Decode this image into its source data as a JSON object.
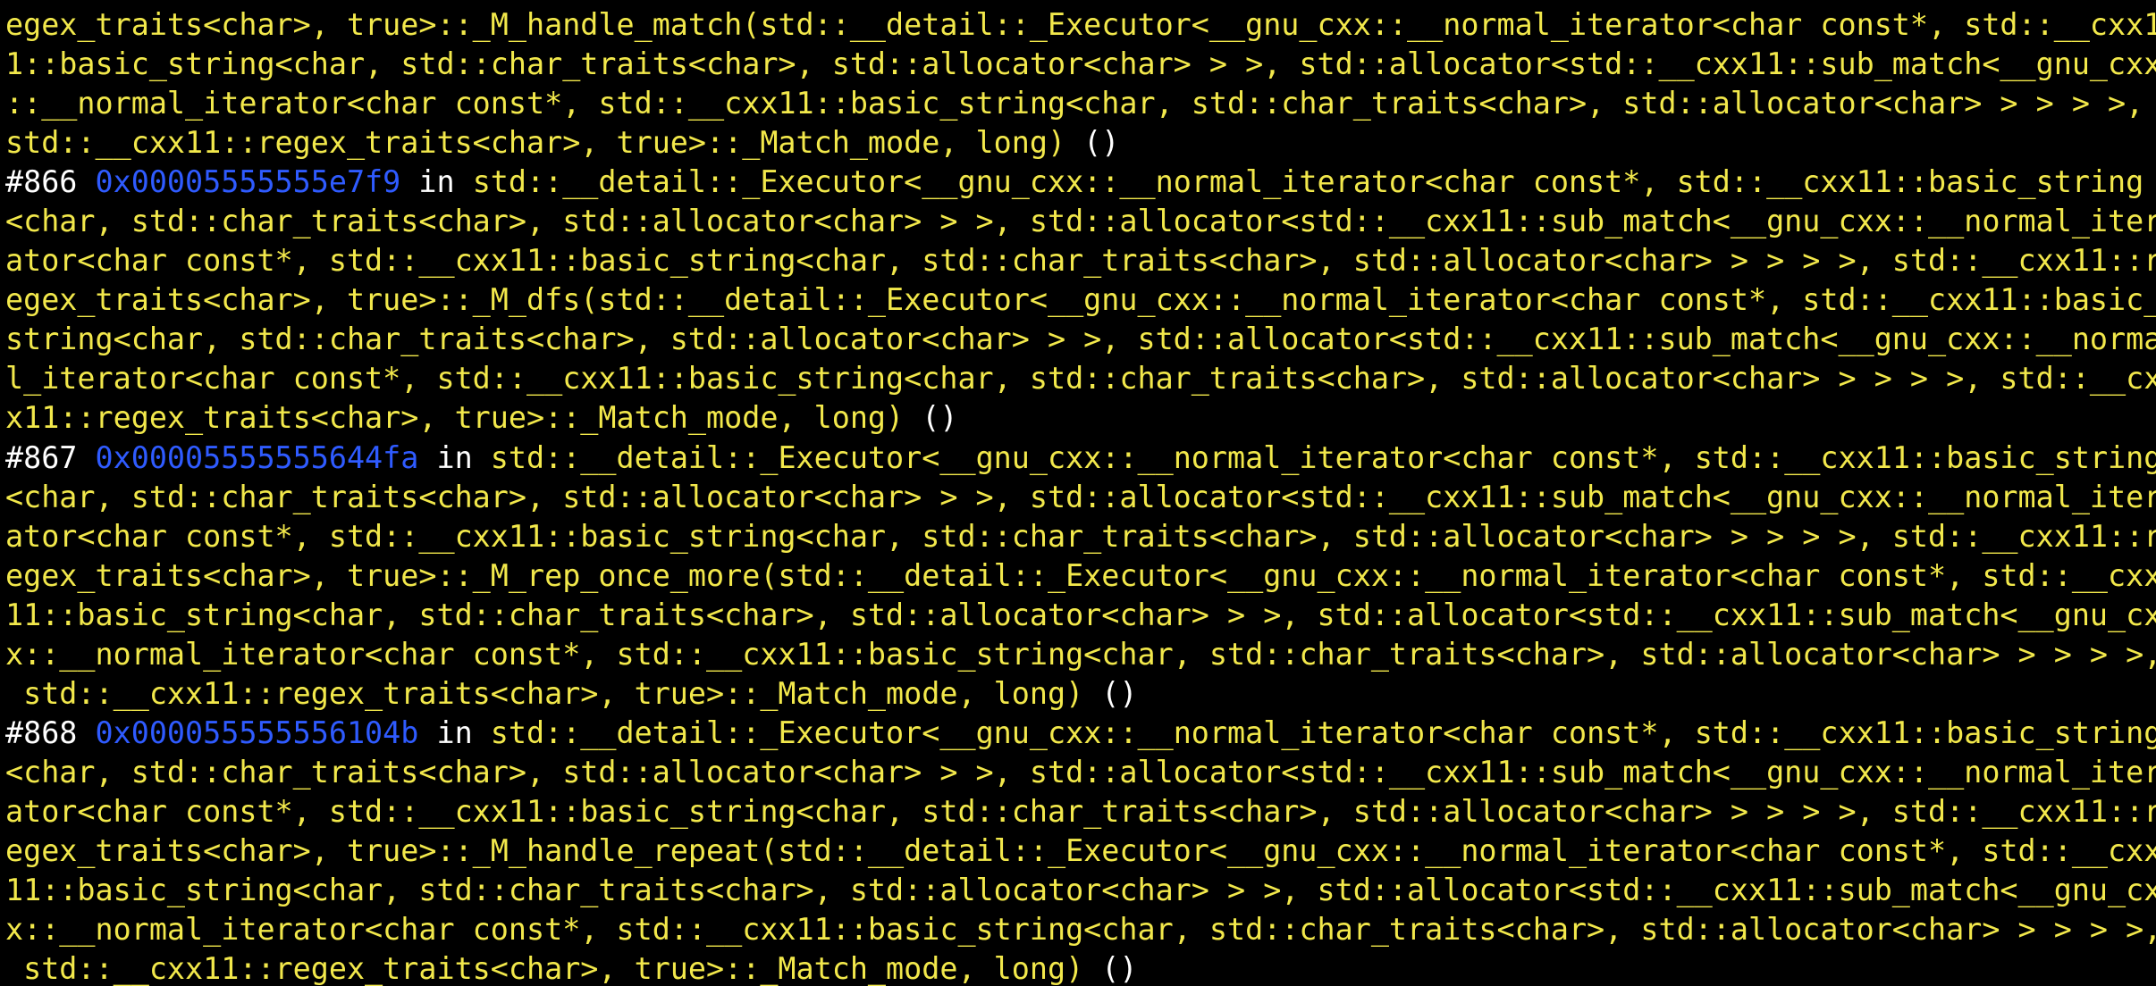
{
  "colors": {
    "background": "#000000",
    "text": "#ffffff",
    "function_text": "#f2e84b",
    "address_text": "#2f5bff"
  },
  "terminal": {
    "lines": [
      {
        "parts": [
          {
            "style": "fn",
            "text": "egex_traits<char>, true>::_M_handle_match(std::__detail::_Executor<__gnu_cxx::__normal_iterator<char const*, std::__cxx1"
          }
        ]
      },
      {
        "parts": [
          {
            "style": "fn",
            "text": "1::basic_string<char, std::char_traits<char>, std::allocator<char> > >, std::allocator<std::__cxx11::sub_match<__gnu_cxx"
          }
        ]
      },
      {
        "parts": [
          {
            "style": "fn",
            "text": "::__normal_iterator<char const*, std::__cxx11::basic_string<char, std::char_traits<char>, std::allocator<char> > > > >,"
          }
        ]
      },
      {
        "parts": [
          {
            "style": "fn",
            "text": "std::__cxx11::regex_traits<char>, true>::_Match_mode, long) "
          },
          {
            "style": "args",
            "text": "()"
          }
        ]
      },
      {
        "parts": [
          {
            "style": "num",
            "text": "#866 "
          },
          {
            "style": "addr",
            "text": "0x00005555555e7f9"
          },
          {
            "style": "kw",
            "text": " in "
          },
          {
            "style": "fn",
            "text": "std::__detail::_Executor<__gnu_cxx::__normal_iterator<char const*, std::__cxx11::basic_string"
          }
        ]
      },
      {
        "parts": [
          {
            "style": "fn",
            "text": "<char, std::char_traits<char>, std::allocator<char> > >, std::allocator<std::__cxx11::sub_match<__gnu_cxx::__normal_iter"
          }
        ]
      },
      {
        "parts": [
          {
            "style": "fn",
            "text": "ator<char const*, std::__cxx11::basic_string<char, std::char_traits<char>, std::allocator<char> > > > >, std::__cxx11::r"
          }
        ]
      },
      {
        "parts": [
          {
            "style": "fn",
            "text": "egex_traits<char>, true>::_M_dfs(std::__detail::_Executor<__gnu_cxx::__normal_iterator<char const*, std::__cxx11::basic_"
          }
        ]
      },
      {
        "parts": [
          {
            "style": "fn",
            "text": "string<char, std::char_traits<char>, std::allocator<char> > >, std::allocator<std::__cxx11::sub_match<__gnu_cxx::__norma"
          }
        ]
      },
      {
        "parts": [
          {
            "style": "fn",
            "text": "l_iterator<char const*, std::__cxx11::basic_string<char, std::char_traits<char>, std::allocator<char> > > > >, std::__cx"
          }
        ]
      },
      {
        "parts": [
          {
            "style": "fn",
            "text": "x11::regex_traits<char>, true>::_Match_mode, long) "
          },
          {
            "style": "args",
            "text": "()"
          }
        ]
      },
      {
        "parts": [
          {
            "style": "num",
            "text": "#867 "
          },
          {
            "style": "addr",
            "text": "0x00005555555644fa"
          },
          {
            "style": "kw",
            "text": " in "
          },
          {
            "style": "fn",
            "text": "std::__detail::_Executor<__gnu_cxx::__normal_iterator<char const*, std::__cxx11::basic_string"
          }
        ]
      },
      {
        "parts": [
          {
            "style": "fn",
            "text": "<char, std::char_traits<char>, std::allocator<char> > >, std::allocator<std::__cxx11::sub_match<__gnu_cxx::__normal_iter"
          }
        ]
      },
      {
        "parts": [
          {
            "style": "fn",
            "text": "ator<char const*, std::__cxx11::basic_string<char, std::char_traits<char>, std::allocator<char> > > > >, std::__cxx11::r"
          }
        ]
      },
      {
        "parts": [
          {
            "style": "fn",
            "text": "egex_traits<char>, true>::_M_rep_once_more(std::__detail::_Executor<__gnu_cxx::__normal_iterator<char const*, std::__cxx"
          }
        ]
      },
      {
        "parts": [
          {
            "style": "fn",
            "text": "11::basic_string<char, std::char_traits<char>, std::allocator<char> > >, std::allocator<std::__cxx11::sub_match<__gnu_cx"
          }
        ]
      },
      {
        "parts": [
          {
            "style": "fn",
            "text": "x::__normal_iterator<char const*, std::__cxx11::basic_string<char, std::char_traits<char>, std::allocator<char> > > > >,"
          }
        ]
      },
      {
        "parts": [
          {
            "style": "fn",
            "text": " std::__cxx11::regex_traits<char>, true>::_Match_mode, long) "
          },
          {
            "style": "args",
            "text": "()"
          }
        ]
      },
      {
        "parts": [
          {
            "style": "num",
            "text": "#868 "
          },
          {
            "style": "addr",
            "text": "0x000055555556104b"
          },
          {
            "style": "kw",
            "text": " in "
          },
          {
            "style": "fn",
            "text": "std::__detail::_Executor<__gnu_cxx::__normal_iterator<char const*, std::__cxx11::basic_string"
          }
        ]
      },
      {
        "parts": [
          {
            "style": "fn",
            "text": "<char, std::char_traits<char>, std::allocator<char> > >, std::allocator<std::__cxx11::sub_match<__gnu_cxx::__normal_iter"
          }
        ]
      },
      {
        "parts": [
          {
            "style": "fn",
            "text": "ator<char const*, std::__cxx11::basic_string<char, std::char_traits<char>, std::allocator<char> > > > >, std::__cxx11::r"
          }
        ]
      },
      {
        "parts": [
          {
            "style": "fn",
            "text": "egex_traits<char>, true>::_M_handle_repeat(std::__detail::_Executor<__gnu_cxx::__normal_iterator<char const*, std::__cxx"
          }
        ]
      },
      {
        "parts": [
          {
            "style": "fn",
            "text": "11::basic_string<char, std::char_traits<char>, std::allocator<char> > >, std::allocator<std::__cxx11::sub_match<__gnu_cx"
          }
        ]
      },
      {
        "parts": [
          {
            "style": "fn",
            "text": "x::__normal_iterator<char const*, std::__cxx11::basic_string<char, std::char_traits<char>, std::allocator<char> > > > >,"
          }
        ]
      },
      {
        "parts": [
          {
            "style": "fn",
            "text": " std::__cxx11::regex_traits<char>, true>::_Match_mode, long) "
          },
          {
            "style": "args",
            "text": "()"
          }
        ]
      }
    ]
  }
}
